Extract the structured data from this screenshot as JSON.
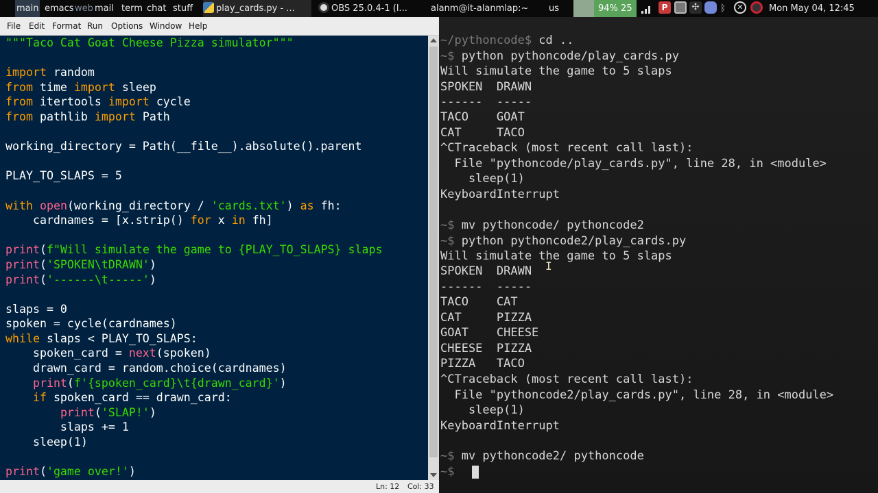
{
  "topbar": {
    "workspaces": [
      "main",
      "emacs",
      "web",
      "mail",
      "term",
      "chat",
      "stuff"
    ],
    "tasks": [
      {
        "label": "play_cards.py - ...",
        "icon": "python-icon"
      },
      {
        "label": "OBS 25.0.4-1 (l...",
        "icon": "obs-icon"
      },
      {
        "label": "alanm@it-alanmlap:~",
        "icon": ""
      }
    ],
    "keyboard": "us",
    "battery": "94%",
    "battery_extra": "25",
    "clock": "Mon May 04, 12:45"
  },
  "editor": {
    "menu": [
      "File",
      "Edit",
      "Format",
      "Run",
      "Options",
      "Window",
      "Help"
    ],
    "status": {
      "line": "Ln: 12",
      "col": "Col: 33"
    },
    "code_lines": [
      [
        [
          "str",
          "\"\"\"Taco Cat Goat Cheese Pizza simulator\"\"\""
        ]
      ],
      [],
      [
        [
          "kw",
          "import"
        ],
        [
          "",
          " random"
        ]
      ],
      [
        [
          "kw",
          "from"
        ],
        [
          "",
          " time "
        ],
        [
          "kw",
          "import"
        ],
        [
          "",
          " sleep"
        ]
      ],
      [
        [
          "kw",
          "from"
        ],
        [
          "",
          " itertools "
        ],
        [
          "kw",
          "import"
        ],
        [
          "",
          " cycle"
        ]
      ],
      [
        [
          "kw",
          "from"
        ],
        [
          "",
          " pathlib "
        ],
        [
          "kw",
          "import"
        ],
        [
          "",
          " Path"
        ]
      ],
      [],
      [
        [
          "",
          "working_directory = Path(__file__).absolute().parent"
        ]
      ],
      [],
      [
        [
          "",
          "PLAY_TO_SLAPS = 5"
        ]
      ],
      [],
      [
        [
          "kw",
          "with"
        ],
        [
          "",
          " "
        ],
        [
          "bi",
          "open"
        ],
        [
          "",
          "(working_directory / "
        ],
        [
          "str",
          "'cards.txt'"
        ],
        [
          "",
          ") "
        ],
        [
          "kw",
          "as"
        ],
        [
          "",
          " fh:"
        ]
      ],
      [
        [
          "",
          "    cardnames = [x.strip() "
        ],
        [
          "kw",
          "for"
        ],
        [
          "",
          " x "
        ],
        [
          "kw",
          "in"
        ],
        [
          "",
          " fh]"
        ]
      ],
      [],
      [
        [
          "bi",
          "print"
        ],
        [
          "",
          "("
        ],
        [
          "str",
          "f\"Will simulate the game to {PLAY_TO_SLAPS} slaps"
        ]
      ],
      [
        [
          "bi",
          "print"
        ],
        [
          "",
          "("
        ],
        [
          "str",
          "'SPOKEN\\tDRAWN'"
        ],
        [
          "",
          ")"
        ]
      ],
      [
        [
          "bi",
          "print"
        ],
        [
          "",
          "("
        ],
        [
          "str",
          "'------\\t-----'"
        ],
        [
          "",
          ")"
        ]
      ],
      [],
      [
        [
          "",
          "slaps = 0"
        ]
      ],
      [
        [
          "",
          "spoken = cycle(cardnames)"
        ]
      ],
      [
        [
          "kw",
          "while"
        ],
        [
          "",
          " slaps < PLAY_TO_SLAPS:"
        ]
      ],
      [
        [
          "",
          "    spoken_card = "
        ],
        [
          "bi",
          "next"
        ],
        [
          "",
          "(spoken)"
        ]
      ],
      [
        [
          "",
          "    drawn_card = random.choice(cardnames)"
        ]
      ],
      [
        [
          "",
          "    "
        ],
        [
          "bi",
          "print"
        ],
        [
          "",
          "("
        ],
        [
          "str",
          "f'{spoken_card}\\t{drawn_card}'"
        ],
        [
          "",
          ")"
        ]
      ],
      [
        [
          "",
          "    "
        ],
        [
          "kw",
          "if"
        ],
        [
          "",
          " spoken_card == drawn_card:"
        ]
      ],
      [
        [
          "",
          "        "
        ],
        [
          "bi",
          "print"
        ],
        [
          "",
          "("
        ],
        [
          "str",
          "'SLAP!'"
        ],
        [
          "",
          ")"
        ]
      ],
      [
        [
          "",
          "        slaps += 1"
        ]
      ],
      [
        [
          "",
          "    sleep(1)"
        ]
      ],
      [],
      [
        [
          "bi",
          "print"
        ],
        [
          "",
          "("
        ],
        [
          "str",
          "'game over!'"
        ],
        [
          "",
          ")"
        ]
      ]
    ]
  },
  "terminal": {
    "lines": [
      {
        "prompt": "~/pythoncode$ ",
        "text": "cd .."
      },
      {
        "prompt": "~$ ",
        "text": "python pythoncode/play_cards.py"
      },
      {
        "prompt": "",
        "text": "Will simulate the game to 5 slaps"
      },
      {
        "prompt": "",
        "text": "SPOKEN  DRAWN"
      },
      {
        "prompt": "",
        "text": "------  -----"
      },
      {
        "prompt": "",
        "text": "TACO    GOAT"
      },
      {
        "prompt": "",
        "text": "CAT     TACO"
      },
      {
        "prompt": "",
        "text": "^CTraceback (most recent call last):"
      },
      {
        "prompt": "",
        "text": "  File \"pythoncode/play_cards.py\", line 28, in <module>"
      },
      {
        "prompt": "",
        "text": "    sleep(1)"
      },
      {
        "prompt": "",
        "text": "KeyboardInterrupt"
      },
      {
        "prompt": "",
        "text": ""
      },
      {
        "prompt": "~$ ",
        "text": "mv pythoncode/ pythoncode2"
      },
      {
        "prompt": "~$ ",
        "text": "python pythoncode2/play_cards.py"
      },
      {
        "prompt": "",
        "text": "Will simulate the game to 5 slaps"
      },
      {
        "prompt": "",
        "text": "SPOKEN  DRAWN"
      },
      {
        "prompt": "",
        "text": "------  -----"
      },
      {
        "prompt": "",
        "text": "TACO    CAT"
      },
      {
        "prompt": "",
        "text": "CAT     PIZZA"
      },
      {
        "prompt": "",
        "text": "GOAT    CHEESE"
      },
      {
        "prompt": "",
        "text": "CHEESE  PIZZA"
      },
      {
        "prompt": "",
        "text": "PIZZA   TACO"
      },
      {
        "prompt": "",
        "text": "^CTraceback (most recent call last):"
      },
      {
        "prompt": "",
        "text": "  File \"pythoncode2/play_cards.py\", line 28, in <module>"
      },
      {
        "prompt": "",
        "text": "    sleep(1)"
      },
      {
        "prompt": "",
        "text": "KeyboardInterrupt"
      },
      {
        "prompt": "",
        "text": ""
      },
      {
        "prompt": "~$ ",
        "text": "mv pythoncode2/ pythoncode"
      },
      {
        "prompt": "~$ ",
        "text": ""
      }
    ]
  }
}
